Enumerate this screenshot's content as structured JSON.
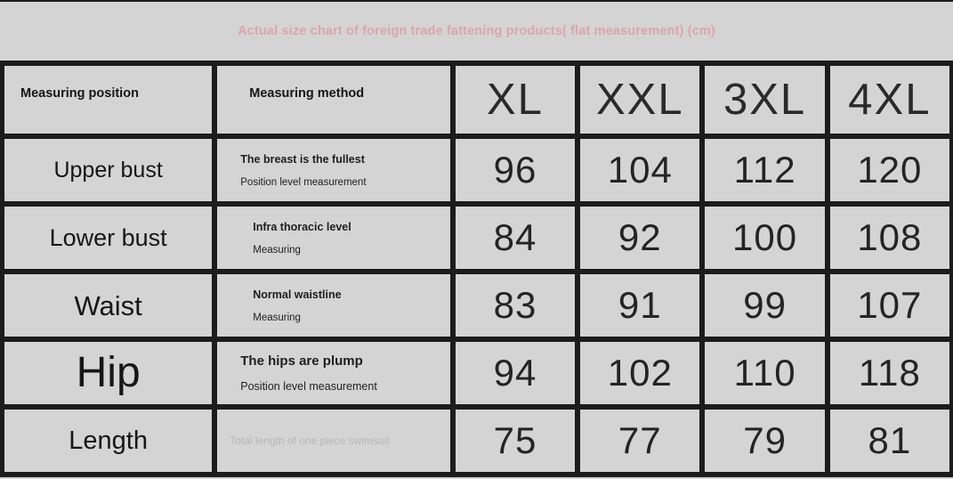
{
  "title": "Actual size chart of foreign trade fattening products( flat measurement) (cm)",
  "title_color": "#dda3ab",
  "grid_color": "#1c1c1c",
  "cell_background": "#d4d4d4",
  "columns": {
    "position_header": "Measuring position",
    "method_header": "Measuring method",
    "sizes": [
      "XL",
      "XXL",
      "3XL",
      "4XL"
    ]
  },
  "rows": [
    {
      "position": "Upper bust",
      "method_line1": "The breast is the fullest",
      "method_line2": "Position level measurement",
      "values": [
        "96",
        "104",
        "112",
        "120"
      ]
    },
    {
      "position": "Lower bust",
      "method_line1": "Infra thoracic level",
      "method_line2": "Measuring",
      "values": [
        "84",
        "92",
        "100",
        "108"
      ]
    },
    {
      "position": "Waist",
      "method_line1": "Normal waistline",
      "method_line2": "Measuring",
      "values": [
        "83",
        "91",
        "99",
        "107"
      ]
    },
    {
      "position": "Hip",
      "method_line1": "The hips are plump",
      "method_line2": "Position level measurement",
      "values": [
        "94",
        "102",
        "110",
        "118"
      ]
    },
    {
      "position": "Length",
      "method_line1": "Total length of one piece swimsuit",
      "method_line2": "",
      "values": [
        "75",
        "77",
        "79",
        "81"
      ]
    }
  ]
}
